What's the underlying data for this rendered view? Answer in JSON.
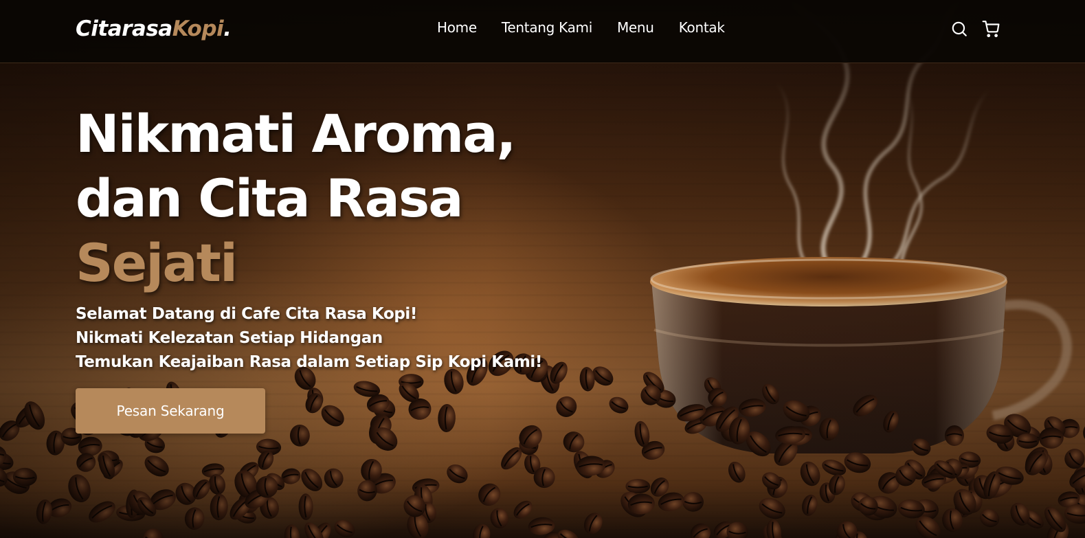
{
  "brand": {
    "name_part1": "Citarasa",
    "name_part2": "Kopi",
    "name_dot": "."
  },
  "nav": {
    "links": [
      {
        "label": "Home"
      },
      {
        "label": "Tentang Kami"
      },
      {
        "label": "Menu"
      },
      {
        "label": "Kontak"
      }
    ],
    "icons": [
      "search-icon",
      "cart-icon"
    ]
  },
  "hero": {
    "title_line1": "Nikmati Aroma,",
    "title_line2": "dan Cita Rasa",
    "title_line3": "Sejati",
    "subtitle_lines": [
      "Selamat Datang di Cafe Cita Rasa Kopi!",
      "Nikmati Kelezatan Setiap Hidangan",
      "Temukan Keajaiban Rasa dalam Setiap Sip Kopi Kami!"
    ],
    "cta_label": "Pesan Sekarang"
  },
  "colors": {
    "accent": "#b6895b",
    "navbar_bg": "#0a0603",
    "text": "#ffffff"
  }
}
